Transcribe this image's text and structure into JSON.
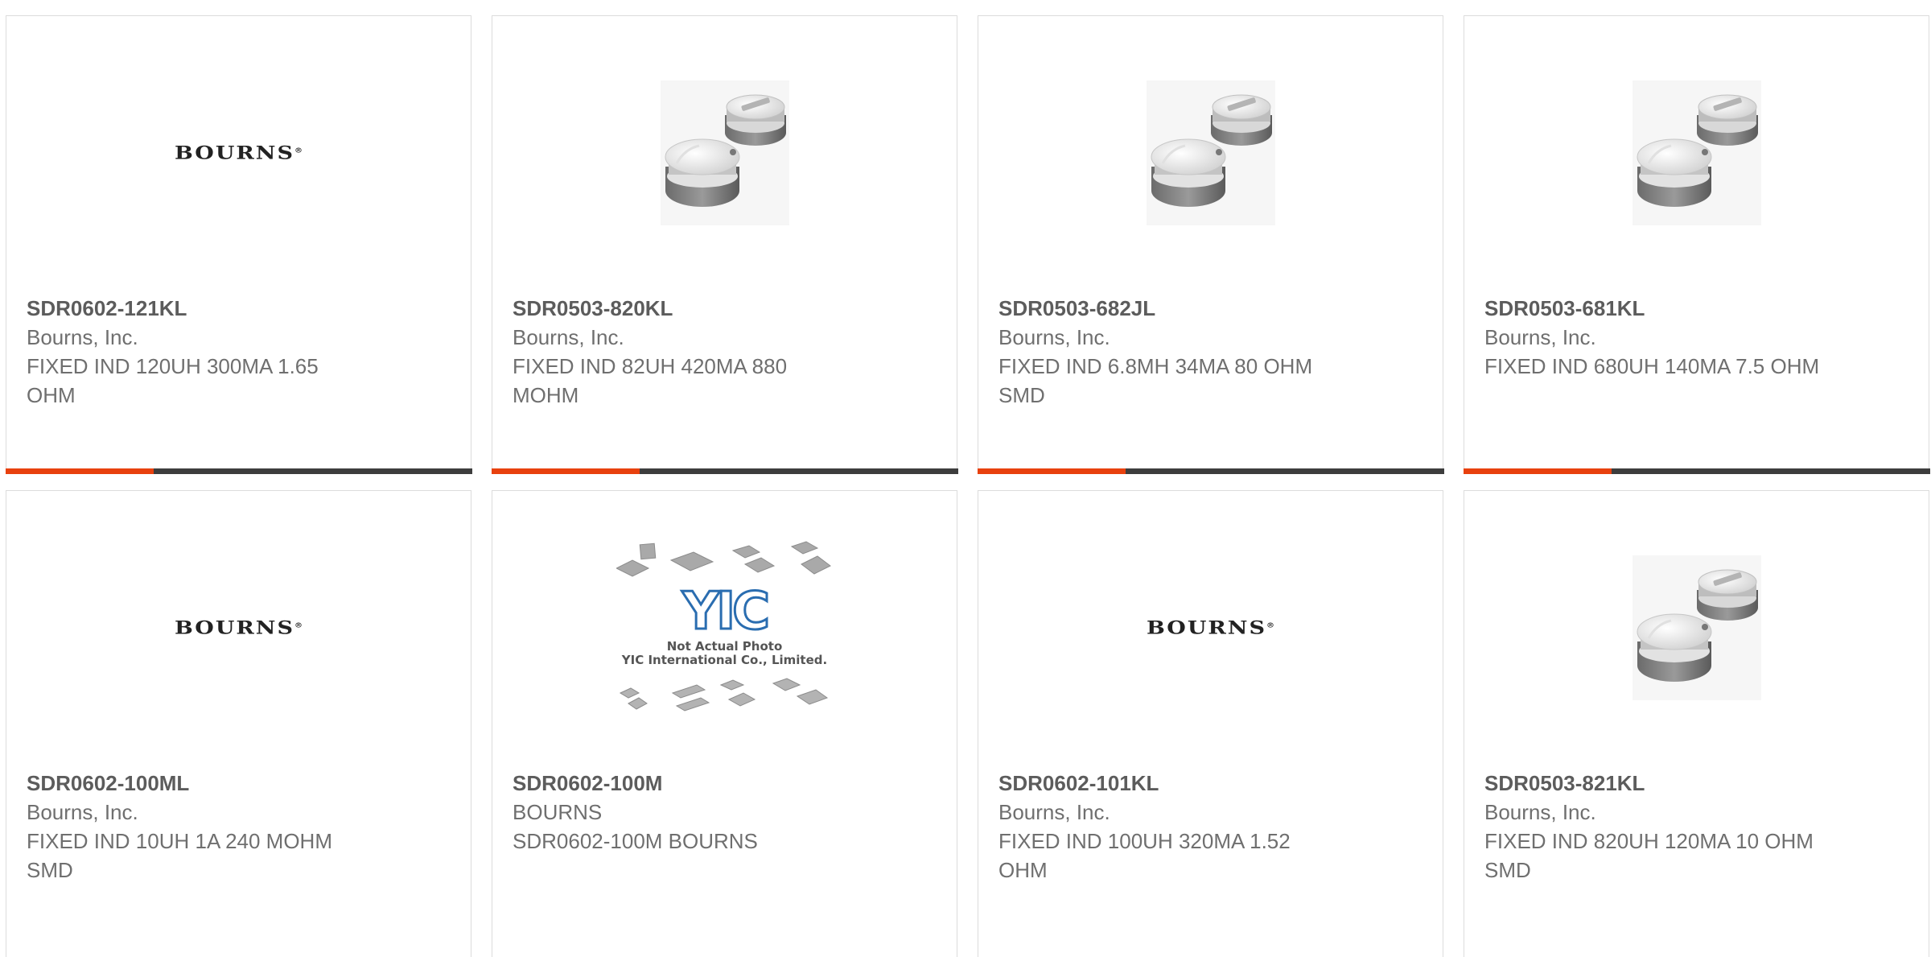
{
  "logo_text": "BOURNS",
  "logo_mark": "®",
  "accent_color": "#e8410e",
  "bar_color": "#3d3d3d",
  "cards": [
    {
      "part_number": "SDR0602-121KL",
      "manufacturer": "Bourns, Inc.",
      "description": "FIXED IND 120UH 300MA 1.65 OHM",
      "image": "bourns-logo"
    },
    {
      "part_number": "SDR0503-820KL",
      "manufacturer": "Bourns, Inc.",
      "description": "FIXED IND 82UH 420MA 880 MOHM",
      "image": "inductor-photo"
    },
    {
      "part_number": "SDR0503-682JL",
      "manufacturer": "Bourns, Inc.",
      "description": "FIXED IND 6.8MH 34MA 80 OHM SMD",
      "image": "inductor-photo"
    },
    {
      "part_number": "SDR0503-681KL",
      "manufacturer": "Bourns, Inc.",
      "description": "FIXED IND 680UH 140MA 7.5 OHM",
      "image": "inductor-photo"
    },
    {
      "part_number": "SDR0602-100ML",
      "manufacturer": "Bourns, Inc.",
      "description": "FIXED IND 10UH 1A 240 MOHM SMD",
      "image": "bourns-logo"
    },
    {
      "part_number": "SDR0602-100M",
      "manufacturer": "BOURNS",
      "description": "SDR0602-100M BOURNS",
      "image": "yic-placeholder"
    },
    {
      "part_number": "SDR0602-101KL",
      "manufacturer": "Bourns, Inc.",
      "description": "FIXED IND 100UH 320MA 1.52 OHM",
      "image": "bourns-logo"
    },
    {
      "part_number": "SDR0503-821KL",
      "manufacturer": "Bourns, Inc.",
      "description": "FIXED IND 820UH 120MA 10 OHM SMD",
      "image": "inductor-photo"
    }
  ],
  "yic": {
    "logo_text": "YIC",
    "caption_line1": "Not Actual Photo",
    "caption_line2": "YIC International Co., Limited."
  }
}
